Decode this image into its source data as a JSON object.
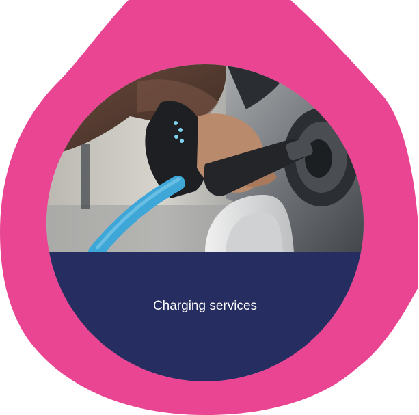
{
  "card": {
    "label": "Charging services",
    "image_alt": "Hand plugging a charging connector into an electric car"
  },
  "colors": {
    "blob": "#e94592",
    "label_band": "#262d60",
    "cable": "#3ea7d8"
  },
  "icons": {
    "photo": "ev-charging-photo"
  }
}
